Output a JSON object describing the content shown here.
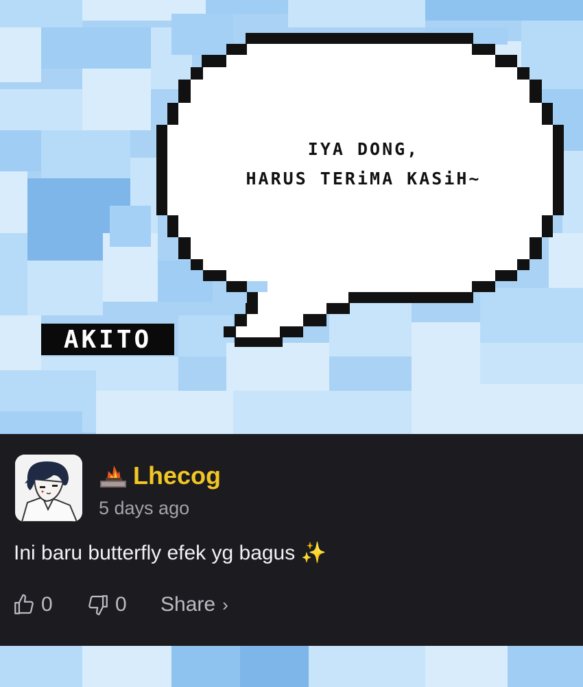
{
  "bubble": {
    "line1": "IYA DONG,",
    "line2": "HARUS TERiMA KASiH~"
  },
  "logo": {
    "text": "AKITO"
  },
  "comment": {
    "username": "Lhecog",
    "timestamp": "5 days ago",
    "text": "Ini baru butterfly efek yg bagus ✨",
    "likes": "0",
    "dislikes": "0",
    "share_label": "Share",
    "share_chevron": "›"
  },
  "icons": {
    "like": "thumbs-up-icon",
    "dislike": "thumbs-down-icon",
    "badge": "campfire-badge-icon",
    "share": "chevron-right-icon"
  },
  "colors": {
    "sky": "#a9d2f5",
    "card_background": "#1b1b20",
    "username": "#f2c624",
    "timestamp": "#a4a4aa",
    "comment_text": "#f2f2f4",
    "action_text": "#bcbcc2"
  }
}
